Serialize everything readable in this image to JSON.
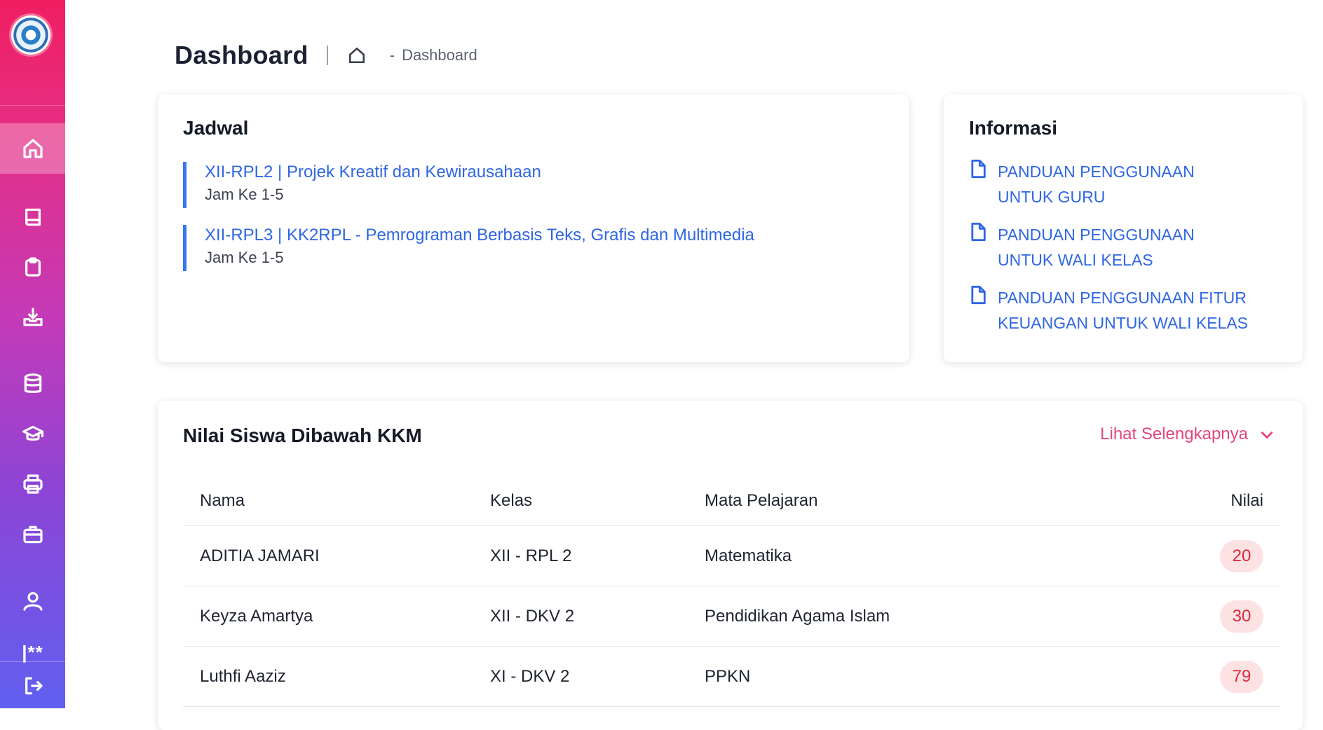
{
  "header": {
    "title": "Dashboard",
    "breadcrumb_separator": "-",
    "breadcrumb_current": "Dashboard"
  },
  "sidebar": {
    "items": [
      {
        "icon": "home-icon",
        "active": true
      },
      {
        "icon": "book-icon"
      },
      {
        "icon": "clipboard-icon"
      },
      {
        "icon": "download-tray-icon"
      },
      {
        "icon": "database-icon"
      },
      {
        "icon": "graduation-cap-icon"
      },
      {
        "icon": "printer-icon"
      },
      {
        "icon": "briefcase-icon"
      },
      {
        "icon": "user-icon"
      },
      {
        "icon": "password-icon",
        "label": "|**"
      },
      {
        "icon": "logout-icon"
      }
    ]
  },
  "jadwal": {
    "title": "Jadwal",
    "items": [
      {
        "title": "XII-RPL2 | Projek Kreatif dan Kewirausahaan",
        "time": "Jam Ke 1-5"
      },
      {
        "title": "XII-RPL3 | KK2RPL - Pemrograman Berbasis Teks, Grafis dan Multimedia",
        "time": "Jam Ke 1-5"
      }
    ]
  },
  "informasi": {
    "title": "Informasi",
    "items": [
      {
        "label": "PANDUAN PENGGUNAAN UNTUK GURU"
      },
      {
        "label": "PANDUAN PENGGUNAAN UNTUK WALI KELAS"
      },
      {
        "label": "PANDUAN PENGGUNAAN FITUR KEUANGAN UNTUK WALI KELAS"
      }
    ]
  },
  "nilai": {
    "title": "Nilai Siswa Dibawah KKM",
    "more_label": "Lihat Selengkapnya",
    "columns": [
      "Nama",
      "Kelas",
      "Mata Pelajaran",
      "Nilai"
    ],
    "rows": [
      {
        "nama": "ADITIA JAMARI",
        "kelas": "XII - RPL 2",
        "mapel": "Matematika",
        "nilai": "20"
      },
      {
        "nama": "Keyza Amartya",
        "kelas": "XII - DKV 2",
        "mapel": "Pendidikan Agama Islam",
        "nilai": "30"
      },
      {
        "nama": "Luthfi Aaziz",
        "kelas": "XI - DKV 2",
        "mapel": "PPKN",
        "nilai": "79"
      }
    ]
  },
  "colors": {
    "accent_link": "#2f66e3",
    "accent_pink": "#e6457c",
    "badge_bg": "#fde2e4",
    "badge_text": "#dc2b3b",
    "sidebar_top": "#f01e61",
    "sidebar_bottom": "#6160f0"
  }
}
